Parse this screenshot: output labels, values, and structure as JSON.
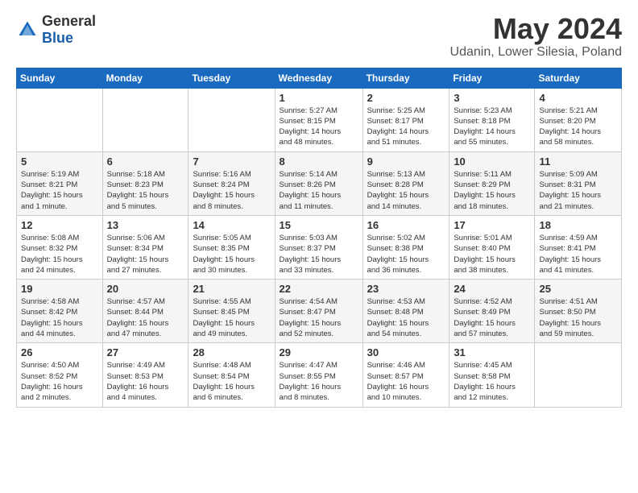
{
  "header": {
    "logo_general": "General",
    "logo_blue": "Blue",
    "month_title": "May 2024",
    "location": "Udanin, Lower Silesia, Poland"
  },
  "days_of_week": [
    "Sunday",
    "Monday",
    "Tuesday",
    "Wednesday",
    "Thursday",
    "Friday",
    "Saturday"
  ],
  "weeks": [
    [
      {
        "day": "",
        "info": ""
      },
      {
        "day": "",
        "info": ""
      },
      {
        "day": "",
        "info": ""
      },
      {
        "day": "1",
        "info": "Sunrise: 5:27 AM\nSunset: 8:15 PM\nDaylight: 14 hours\nand 48 minutes."
      },
      {
        "day": "2",
        "info": "Sunrise: 5:25 AM\nSunset: 8:17 PM\nDaylight: 14 hours\nand 51 minutes."
      },
      {
        "day": "3",
        "info": "Sunrise: 5:23 AM\nSunset: 8:18 PM\nDaylight: 14 hours\nand 55 minutes."
      },
      {
        "day": "4",
        "info": "Sunrise: 5:21 AM\nSunset: 8:20 PM\nDaylight: 14 hours\nand 58 minutes."
      }
    ],
    [
      {
        "day": "5",
        "info": "Sunrise: 5:19 AM\nSunset: 8:21 PM\nDaylight: 15 hours\nand 1 minute."
      },
      {
        "day": "6",
        "info": "Sunrise: 5:18 AM\nSunset: 8:23 PM\nDaylight: 15 hours\nand 5 minutes."
      },
      {
        "day": "7",
        "info": "Sunrise: 5:16 AM\nSunset: 8:24 PM\nDaylight: 15 hours\nand 8 minutes."
      },
      {
        "day": "8",
        "info": "Sunrise: 5:14 AM\nSunset: 8:26 PM\nDaylight: 15 hours\nand 11 minutes."
      },
      {
        "day": "9",
        "info": "Sunrise: 5:13 AM\nSunset: 8:28 PM\nDaylight: 15 hours\nand 14 minutes."
      },
      {
        "day": "10",
        "info": "Sunrise: 5:11 AM\nSunset: 8:29 PM\nDaylight: 15 hours\nand 18 minutes."
      },
      {
        "day": "11",
        "info": "Sunrise: 5:09 AM\nSunset: 8:31 PM\nDaylight: 15 hours\nand 21 minutes."
      }
    ],
    [
      {
        "day": "12",
        "info": "Sunrise: 5:08 AM\nSunset: 8:32 PM\nDaylight: 15 hours\nand 24 minutes."
      },
      {
        "day": "13",
        "info": "Sunrise: 5:06 AM\nSunset: 8:34 PM\nDaylight: 15 hours\nand 27 minutes."
      },
      {
        "day": "14",
        "info": "Sunrise: 5:05 AM\nSunset: 8:35 PM\nDaylight: 15 hours\nand 30 minutes."
      },
      {
        "day": "15",
        "info": "Sunrise: 5:03 AM\nSunset: 8:37 PM\nDaylight: 15 hours\nand 33 minutes."
      },
      {
        "day": "16",
        "info": "Sunrise: 5:02 AM\nSunset: 8:38 PM\nDaylight: 15 hours\nand 36 minutes."
      },
      {
        "day": "17",
        "info": "Sunrise: 5:01 AM\nSunset: 8:40 PM\nDaylight: 15 hours\nand 38 minutes."
      },
      {
        "day": "18",
        "info": "Sunrise: 4:59 AM\nSunset: 8:41 PM\nDaylight: 15 hours\nand 41 minutes."
      }
    ],
    [
      {
        "day": "19",
        "info": "Sunrise: 4:58 AM\nSunset: 8:42 PM\nDaylight: 15 hours\nand 44 minutes."
      },
      {
        "day": "20",
        "info": "Sunrise: 4:57 AM\nSunset: 8:44 PM\nDaylight: 15 hours\nand 47 minutes."
      },
      {
        "day": "21",
        "info": "Sunrise: 4:55 AM\nSunset: 8:45 PM\nDaylight: 15 hours\nand 49 minutes."
      },
      {
        "day": "22",
        "info": "Sunrise: 4:54 AM\nSunset: 8:47 PM\nDaylight: 15 hours\nand 52 minutes."
      },
      {
        "day": "23",
        "info": "Sunrise: 4:53 AM\nSunset: 8:48 PM\nDaylight: 15 hours\nand 54 minutes."
      },
      {
        "day": "24",
        "info": "Sunrise: 4:52 AM\nSunset: 8:49 PM\nDaylight: 15 hours\nand 57 minutes."
      },
      {
        "day": "25",
        "info": "Sunrise: 4:51 AM\nSunset: 8:50 PM\nDaylight: 15 hours\nand 59 minutes."
      }
    ],
    [
      {
        "day": "26",
        "info": "Sunrise: 4:50 AM\nSunset: 8:52 PM\nDaylight: 16 hours\nand 2 minutes."
      },
      {
        "day": "27",
        "info": "Sunrise: 4:49 AM\nSunset: 8:53 PM\nDaylight: 16 hours\nand 4 minutes."
      },
      {
        "day": "28",
        "info": "Sunrise: 4:48 AM\nSunset: 8:54 PM\nDaylight: 16 hours\nand 6 minutes."
      },
      {
        "day": "29",
        "info": "Sunrise: 4:47 AM\nSunset: 8:55 PM\nDaylight: 16 hours\nand 8 minutes."
      },
      {
        "day": "30",
        "info": "Sunrise: 4:46 AM\nSunset: 8:57 PM\nDaylight: 16 hours\nand 10 minutes."
      },
      {
        "day": "31",
        "info": "Sunrise: 4:45 AM\nSunset: 8:58 PM\nDaylight: 16 hours\nand 12 minutes."
      },
      {
        "day": "",
        "info": ""
      }
    ]
  ]
}
